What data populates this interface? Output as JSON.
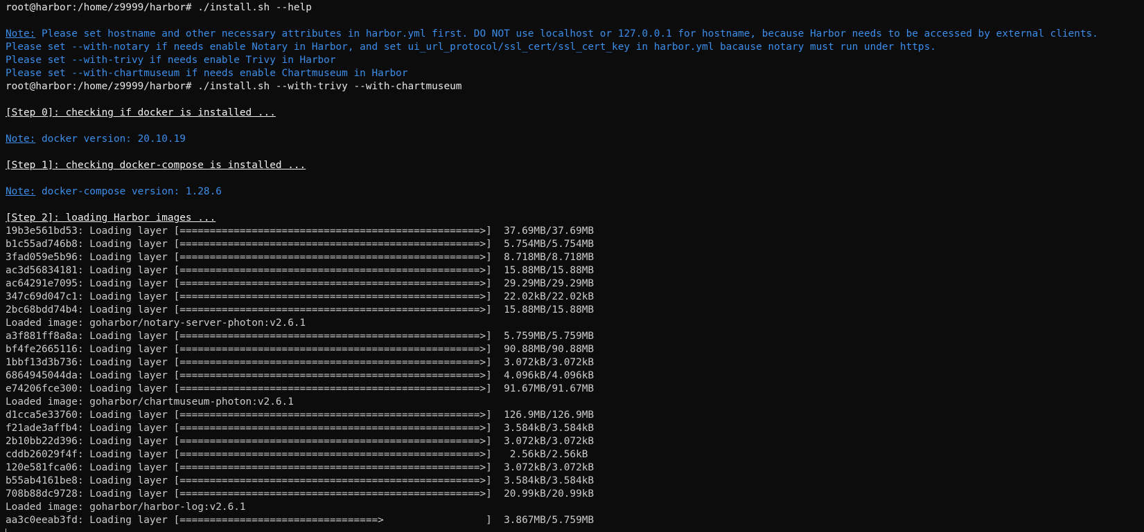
{
  "terminal": {
    "lines": [
      {
        "type": "cmd",
        "text": "root@harbor:/home/z9999/harbor# ./install.sh --help"
      },
      {
        "type": "blank"
      },
      {
        "type": "note",
        "label": "Note:",
        "text": " Please set hostname and other necessary attributes in harbor.yml first. DO NOT use localhost or 127.0.0.1 for hostname, because Harbor needs to be accessed by external clients."
      },
      {
        "type": "blue",
        "text": "Please set --with-notary if needs enable Notary in Harbor, and set ui_url_protocol/ssl_cert/ssl_cert_key in harbor.yml bacause notary must run under https."
      },
      {
        "type": "blue",
        "text": "Please set --with-trivy if needs enable Trivy in Harbor"
      },
      {
        "type": "blue",
        "text": "Please set --with-chartmuseum if needs enable Chartmuseum in Harbor"
      },
      {
        "type": "cmd",
        "text": "root@harbor:/home/z9999/harbor# ./install.sh --with-trivy --with-chartmuseum"
      },
      {
        "type": "blank"
      },
      {
        "type": "step",
        "text": "[Step 0]: checking if docker is installed ..."
      },
      {
        "type": "blank"
      },
      {
        "type": "note",
        "label": "Note:",
        "text": " docker version: 20.10.19"
      },
      {
        "type": "blank"
      },
      {
        "type": "step",
        "text": "[Step 1]: checking docker-compose is installed ..."
      },
      {
        "type": "blank"
      },
      {
        "type": "note",
        "label": "Note:",
        "text": " docker-compose version: 1.28.6"
      },
      {
        "type": "blank"
      },
      {
        "type": "step",
        "text": "[Step 2]: loading Harbor images ..."
      },
      {
        "type": "plain",
        "text": "19b3e561bd53: Loading layer [==================================================>]  37.69MB/37.69MB"
      },
      {
        "type": "plain",
        "text": "b1c55ad746b8: Loading layer [==================================================>]  5.754MB/5.754MB"
      },
      {
        "type": "plain",
        "text": "3fad059e5b96: Loading layer [==================================================>]  8.718MB/8.718MB"
      },
      {
        "type": "plain",
        "text": "ac3d56834181: Loading layer [==================================================>]  15.88MB/15.88MB"
      },
      {
        "type": "plain",
        "text": "ac64291e7095: Loading layer [==================================================>]  29.29MB/29.29MB"
      },
      {
        "type": "plain",
        "text": "347c69d047c1: Loading layer [==================================================>]  22.02kB/22.02kB"
      },
      {
        "type": "plain",
        "text": "2bc68bdd74b4: Loading layer [==================================================>]  15.88MB/15.88MB"
      },
      {
        "type": "plain",
        "text": "Loaded image: goharbor/notary-server-photon:v2.6.1"
      },
      {
        "type": "plain",
        "text": "a3f881ff8a8a: Loading layer [==================================================>]  5.759MB/5.759MB"
      },
      {
        "type": "plain",
        "text": "bf4fe2665116: Loading layer [==================================================>]  90.88MB/90.88MB"
      },
      {
        "type": "plain",
        "text": "1bbf13d3b736: Loading layer [==================================================>]  3.072kB/3.072kB"
      },
      {
        "type": "plain",
        "text": "686494504 4da: Loading layer [==================================================>]  4.096kB/4.096kB"
      },
      {
        "type": "plain",
        "text": "e74206fce300: Loading layer [==================================================>]  91.67MB/91.67MB"
      },
      {
        "type": "plain",
        "text": "Loaded image: goharbor/chartmuseum-photon:v2.6.1"
      },
      {
        "type": "plain",
        "text": "d1cca5e33760: Loading layer [==================================================>]  126.9MB/126.9MB"
      },
      {
        "type": "plain",
        "text": "f21ade3affb4: Loading layer [==================================================>]  3.584kB/3.584kB"
      },
      {
        "type": "plain",
        "text": "2b10bb22d396: Loading layer [==================================================>]  3.072kB/3.072kB"
      },
      {
        "type": "plain",
        "text": "cddb26029f4f: Loading layer [==================================================>]   2.56kB/2.56kB"
      },
      {
        "type": "plain",
        "text": "120e581fca06: Loading layer [==================================================>]  3.072kB/3.072kB"
      },
      {
        "type": "plain",
        "text": "b55ab4161be8: Loading layer [==================================================>]  3.584kB/3.584kB"
      },
      {
        "type": "plain",
        "text": "708b88dc9728: Loading layer [==================================================>]  20.99kB/20.99kB"
      },
      {
        "type": "plain",
        "text": "Loaded image: goharbor/harbor-log:v2.6.1"
      },
      {
        "type": "plain",
        "text": "aa3c0eeab3fd: Loading layer [=================================>                 ]  3.867MB/5.759MB"
      }
    ]
  },
  "colors": {
    "background": "#0c0c0c",
    "foreground": "#cccccc",
    "note_blue": "#3b8eea",
    "step_white": "#f2f2f2"
  }
}
